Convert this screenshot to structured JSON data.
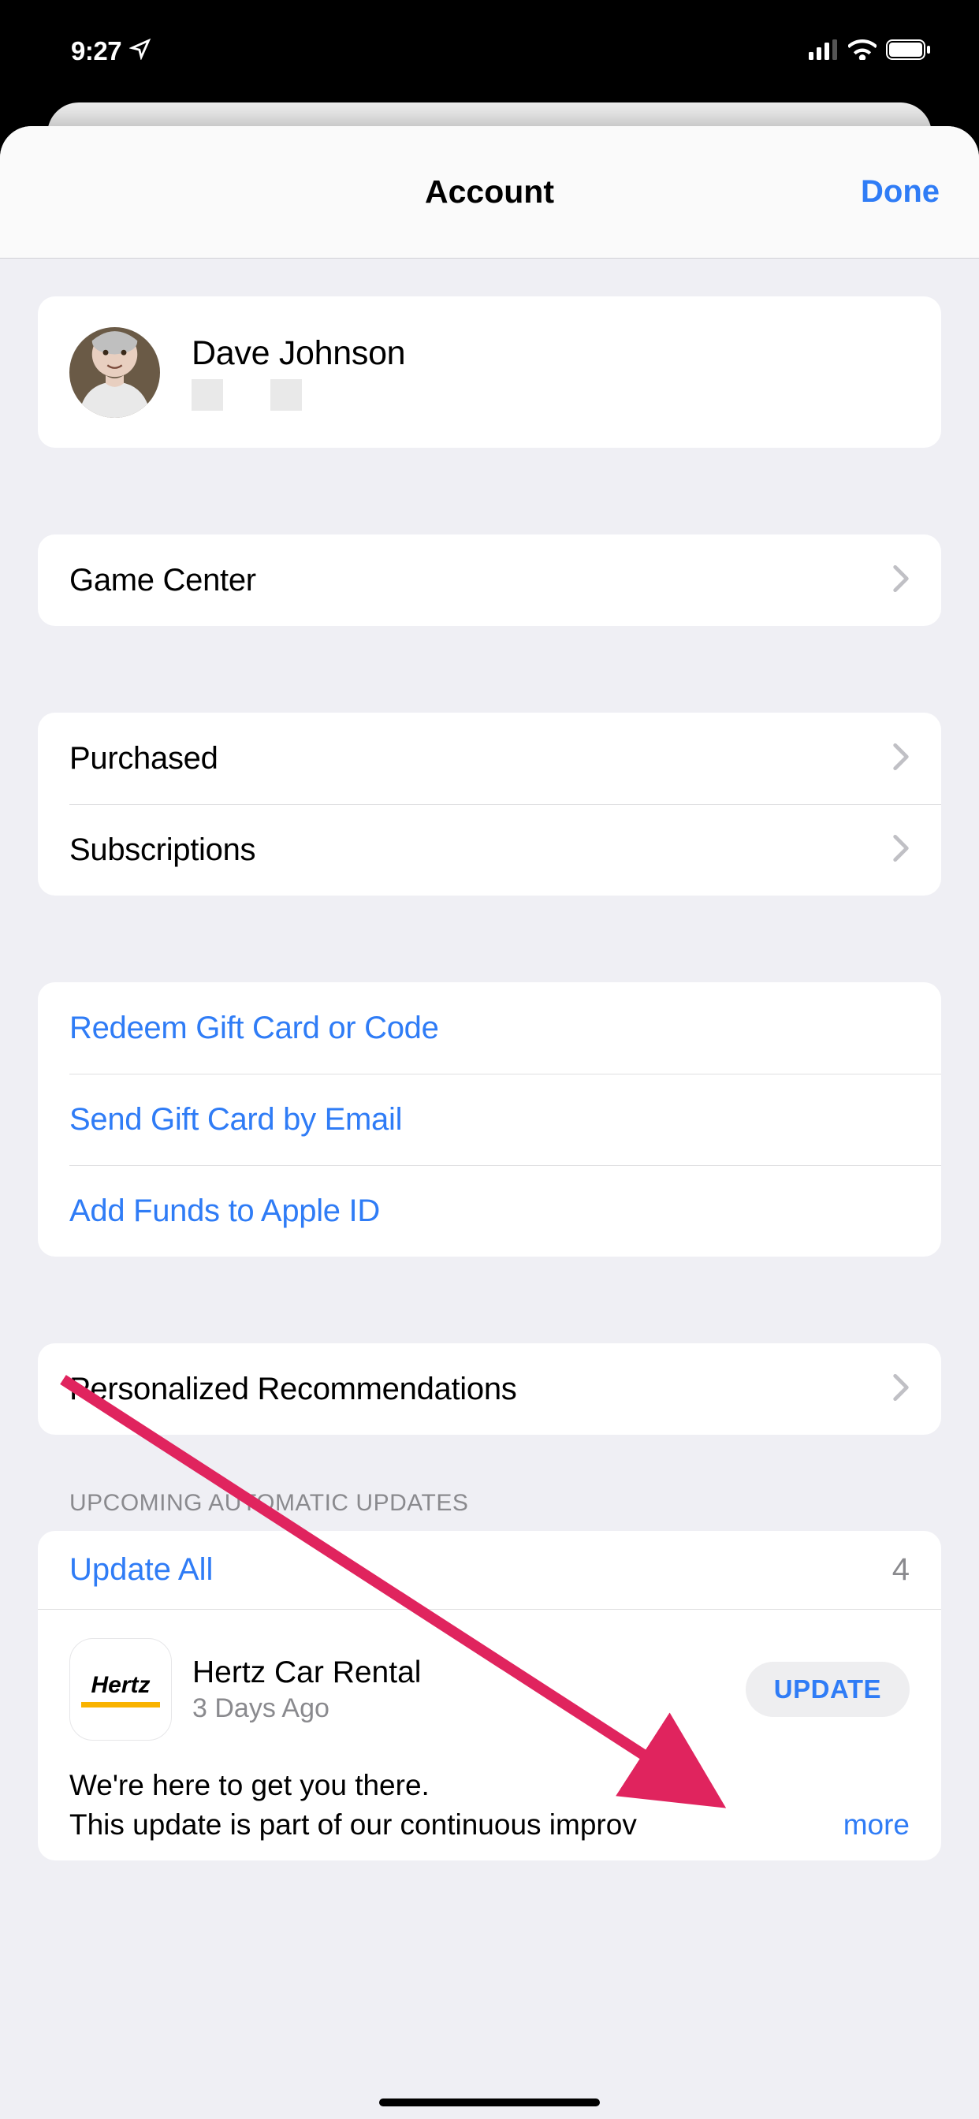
{
  "status_bar": {
    "time": "9:27"
  },
  "navbar": {
    "title": "Account",
    "done_label": "Done"
  },
  "profile": {
    "name": "Dave Johnson"
  },
  "menu": {
    "game_center": "Game Center",
    "purchased": "Purchased",
    "subscriptions": "Subscriptions",
    "redeem": "Redeem Gift Card or Code",
    "send_gift": "Send Gift Card by Email",
    "add_funds": "Add Funds to Apple ID",
    "personalized": "Personalized Recommendations"
  },
  "updates": {
    "section_header": "UPCOMING AUTOMATIC UPDATES",
    "update_all_label": "Update All",
    "count": "4",
    "items": [
      {
        "icon_text": "Hertz",
        "name": "Hertz Car Rental",
        "age": "3 Days Ago",
        "button_label": "UPDATE",
        "notes_line1": "We're here to get you there.",
        "notes_line2": "This update is part of our continuous improv",
        "more_label": "more"
      }
    ]
  }
}
